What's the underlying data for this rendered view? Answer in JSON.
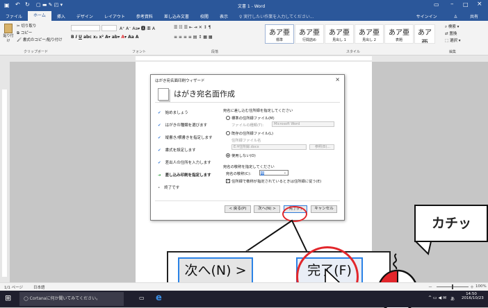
{
  "window": {
    "title": "文書 1 - Word",
    "search_hint": "♀ 実行したい作業を入力してください...",
    "user": "サインイン",
    "share": "共有"
  },
  "tabs": [
    "ファイル",
    "ホーム",
    "挿入",
    "デザイン",
    "レイアウト",
    "参考資料",
    "差し込み文書",
    "校閲",
    "表示"
  ],
  "active_tab": "ホーム",
  "ribbon": {
    "clipboard": {
      "label": "クリップボード",
      "paste": "貼り付け",
      "cut": "切り取り",
      "copy": "コピー",
      "format_painter": "書式のコピー/貼り付け"
    },
    "font_label": "フォント",
    "paragraph_label": "段落",
    "styles_label": "スタイル",
    "editing_label": "編集",
    "find": "検索",
    "replace": "置換",
    "select": "選択",
    "styles": [
      {
        "sample": "あア亜",
        "name": "標準"
      },
      {
        "sample": "あア亜",
        "name": "行間詰め"
      },
      {
        "sample": "あア亜",
        "name": "見出し 1"
      },
      {
        "sample": "あア亜",
        "name": "見出し 2"
      },
      {
        "sample": "あア亜",
        "name": "表題"
      },
      {
        "sample": "あア亜",
        "name": "副題"
      },
      {
        "sample": "あア亜",
        "name": "斜体"
      }
    ]
  },
  "dialog": {
    "title": "はがき宛名面印刷ウィザード",
    "heading": "はがき宛名面作成",
    "close": "×",
    "steps": [
      {
        "label": "始めましょう",
        "mark": "✔"
      },
      {
        "label": "はがきの種類を選びます",
        "mark": "✔"
      },
      {
        "label": "縦書き/横書きを指定します",
        "mark": "✔"
      },
      {
        "label": "書式を設定します",
        "mark": "✔"
      },
      {
        "label": "差出人の住所を入力します",
        "mark": "✔"
      },
      {
        "label": "差し込み印刷を指定します",
        "mark": "➔"
      },
      {
        "label": "終了です",
        "mark": "•"
      }
    ],
    "address_prompt": "宛名に差し込む住所録を指定してください",
    "opt_standard": "標準の住所録ファイル(M)",
    "file_type_label": "ファイルの種類(T):",
    "file_type_value": "Microsoft Word",
    "opt_existing": "既存の住所録ファイル(L)",
    "file_name_label": "住所録ファイル名",
    "file_name_value": "E:¥住所録.docx",
    "browse": "参照(B)...",
    "opt_none": "使用しない(O)",
    "honorific_prompt": "宛名の敬称を指定してください",
    "honorific_label": "宛名の敬称(C):",
    "honorific_value": "様",
    "honorific_check": "住所録で敬称が指定されているときは住所録に従う(E)",
    "btn_back": "< 戻る(P)",
    "btn_next": "次へ(N) >",
    "btn_finish": "完了(F)",
    "btn_cancel": "キャンセル"
  },
  "zoom": {
    "next": "次へ(N) >",
    "finish": "完了(F)"
  },
  "callout": "カチッ",
  "statusbar": {
    "page": "1/1 ページ",
    "language": "日本語",
    "zoom": "100%"
  },
  "taskbar": {
    "cortana": "Cortanaに何か聞いてみてください。",
    "time": "14:50",
    "date": "2016/10/23",
    "ime": "あ"
  },
  "colors": {
    "word_blue": "#2b579a",
    "highlight_red": "#e2262b",
    "button_blue": "#2a82e6"
  }
}
